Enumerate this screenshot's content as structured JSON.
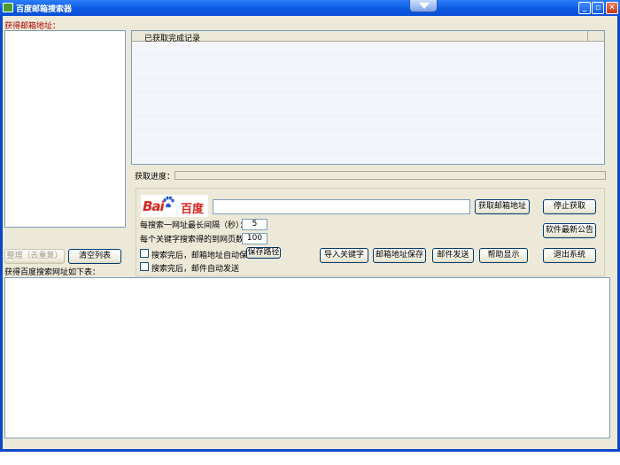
{
  "window": {
    "title": "百度邮箱搜索器"
  },
  "left": {
    "emails_label": "获得邮箱地址：",
    "btn_dedupe": "整理（去重复）",
    "btn_clear": "清空列表",
    "urls_label": "获得百度搜索网址如下表："
  },
  "log": {
    "header": "已获取完成记录"
  },
  "progress": {
    "label": "获取进度：",
    "value": 0
  },
  "search": {
    "keyword_value": "",
    "btn_get_emails": "获取邮箱地址",
    "btn_stop": "停止获取",
    "interval_label": "每搜索一网址最长间隔（秒）：",
    "interval_value": "5",
    "pages_label": "每个关键字搜索得的到网页数量",
    "pages_value": "100",
    "btn_notice": "软件最新公告",
    "autosave_label": "搜索完后，邮箱地址自动保存",
    "btn_save_path": "保存路径",
    "autosend_label": "搜索完后，邮件自动发送",
    "btn_import": "导入关键字",
    "btn_save_emails": "邮箱地址保存",
    "btn_send_mail": "邮件发送",
    "btn_help": "帮助显示",
    "btn_exit": "退出系统"
  },
  "logo": {
    "latin": "Bai",
    "cn": "百度"
  },
  "colors": {
    "title_bar": "#0b58e0",
    "window_bg": "#ece9d8",
    "red_label": "#b00000",
    "logo_red": "#d8261c"
  }
}
